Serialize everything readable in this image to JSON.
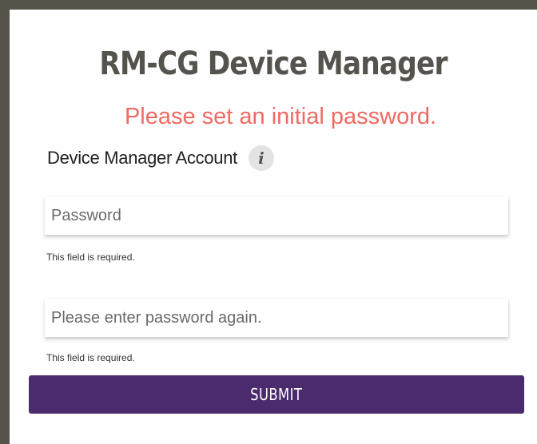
{
  "header": {
    "title": "RM-CG Device Manager",
    "alert": "Please set an initial password."
  },
  "form": {
    "section_label": "Device Manager Account",
    "info_icon_glyph": "i",
    "password": {
      "placeholder": "Password",
      "value": "",
      "hint": "This field is required."
    },
    "confirm_password": {
      "placeholder": "Please enter password again.",
      "value": "",
      "hint": "This field is required."
    },
    "submit_label": "SUBMIT"
  },
  "colors": {
    "border": "#55534a",
    "title": "#55534e",
    "alert": "#f06a62",
    "button": "#4b2a6e"
  }
}
